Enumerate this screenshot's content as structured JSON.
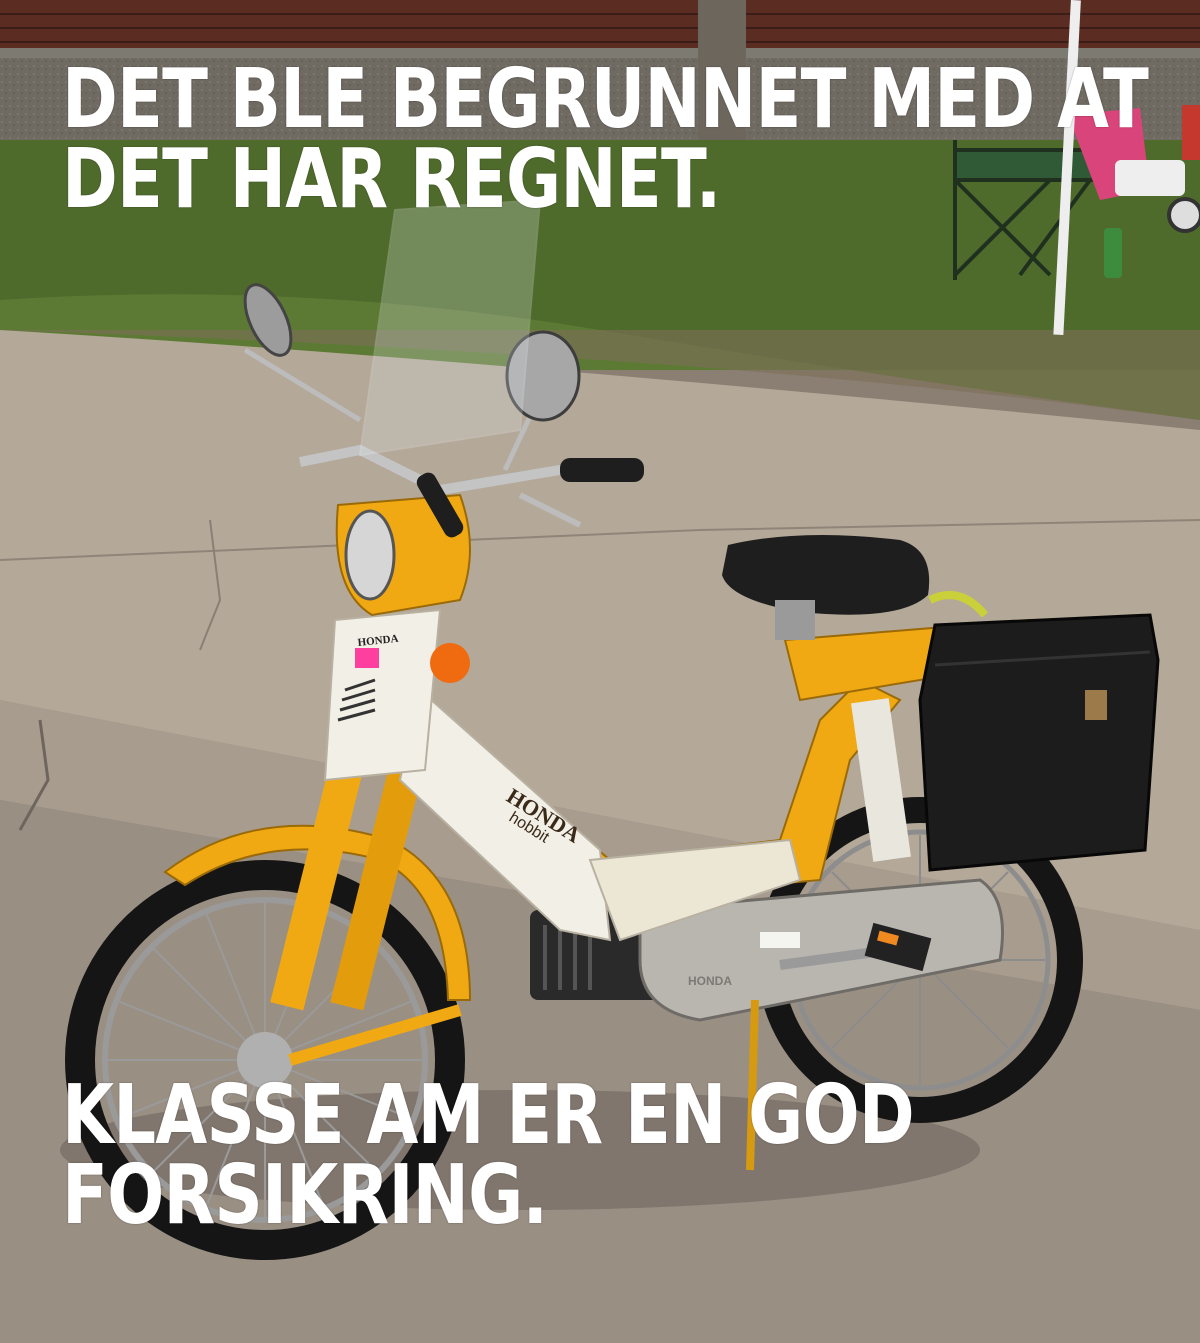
{
  "meme": {
    "top_text": [
      "DET BLE BEGRUNNET MED AT",
      "DET HAR REGNET."
    ],
    "bottom_text": [
      "KLASSE AM ER EN GOD",
      "FORSIKRING."
    ]
  },
  "photo": {
    "bike_badges": {
      "headlight_badge": "HONDA",
      "tank_logo": "HONDA",
      "tank_model": "hobbit",
      "engine_badge": "HONDA"
    }
  },
  "colors": {
    "caption": "#ffffff",
    "bike_yellow": "#f0a913",
    "bike_white": "#f2efe6",
    "bag_black": "#1c1c1c",
    "asphalt": "#9a8f83",
    "sidewalk": "#b4a898",
    "grass": "#4f6b2c",
    "brick": "#5a2c22"
  }
}
